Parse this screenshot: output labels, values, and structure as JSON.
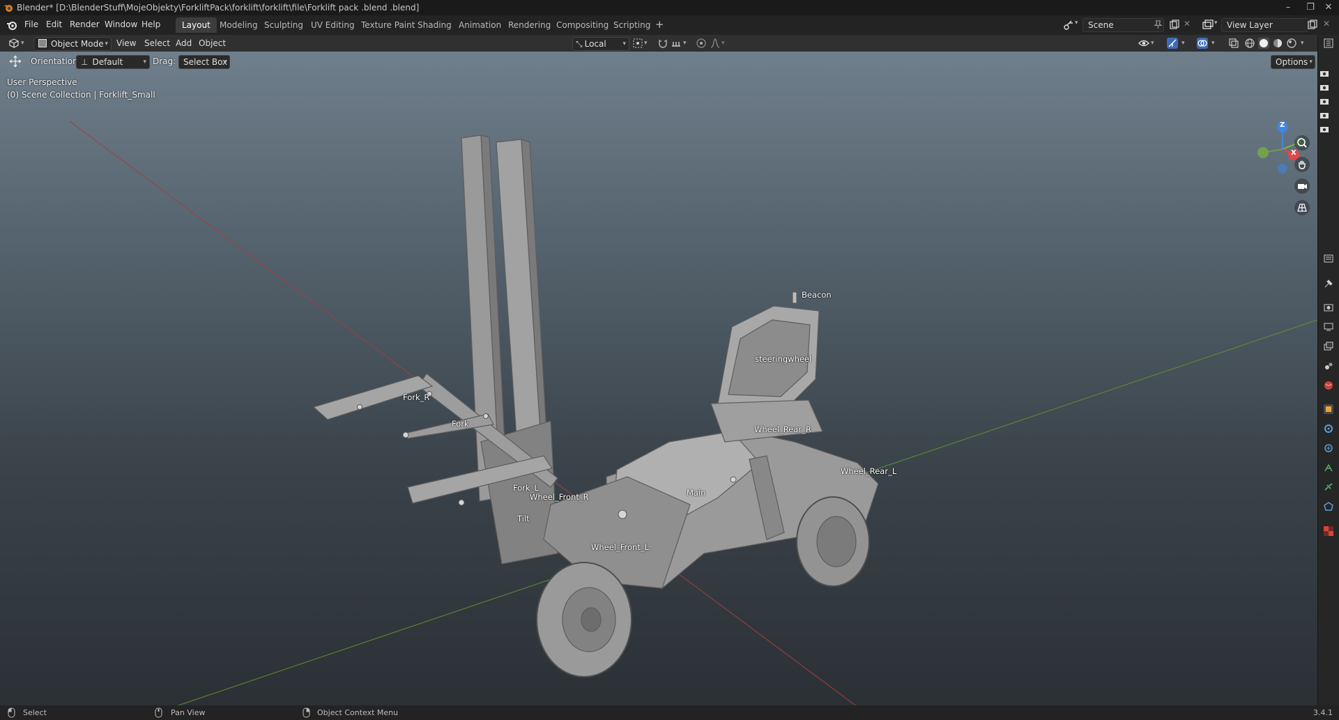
{
  "window": {
    "title": "Blender* [D:\\BlenderStuff\\MojeObjekty\\ForkliftPack\\forklift\\forklift\\file\\Forklift pack .blend .blend]",
    "controls": [
      "minimize",
      "restore",
      "close"
    ]
  },
  "menu": [
    "File",
    "Edit",
    "Render",
    "Window",
    "Help"
  ],
  "workspaces": {
    "tabs": [
      "Layout",
      "Modeling",
      "Sculpting",
      "UV Editing",
      "Texture Paint",
      "Shading",
      "Animation",
      "Rendering",
      "Compositing",
      "Scripting"
    ],
    "active": "Layout",
    "add_label": "+"
  },
  "scene": {
    "name": "Scene"
  },
  "view_layer": {
    "name": "View Layer"
  },
  "header": {
    "mode": "Object Mode",
    "menus": [
      "View",
      "Select",
      "Add",
      "Object"
    ],
    "transform_orientation": "Local"
  },
  "toolsettings": {
    "orientation_label": "Orientation:",
    "orientation_value": "Default",
    "drag_label": "Drag:",
    "drag_value": "Select Box",
    "options_label": "Options"
  },
  "viewport": {
    "view_name": "User Perspective",
    "collection_info": "(0) Scene Collection | Forklift_Small",
    "object_labels": [
      "Beacon",
      "steeringwheel",
      "Fork_R",
      "Fork",
      "Wheel_Rear_R",
      "Wheel_Rear_L",
      "Fork_L",
      "Wheel_Front_R",
      "Main",
      "Tilt",
      "Wheel_Front_L"
    ],
    "gizmo_axes": [
      "Z",
      "Y",
      "X"
    ],
    "colors": {
      "x_axis": "#e0474b",
      "y_axis": "#7ab738",
      "z_axis": "#3f86e0"
    }
  },
  "statusbar": {
    "hints": [
      "Select",
      "Pan View",
      "Object Context Menu"
    ],
    "version": "3.4.1"
  }
}
